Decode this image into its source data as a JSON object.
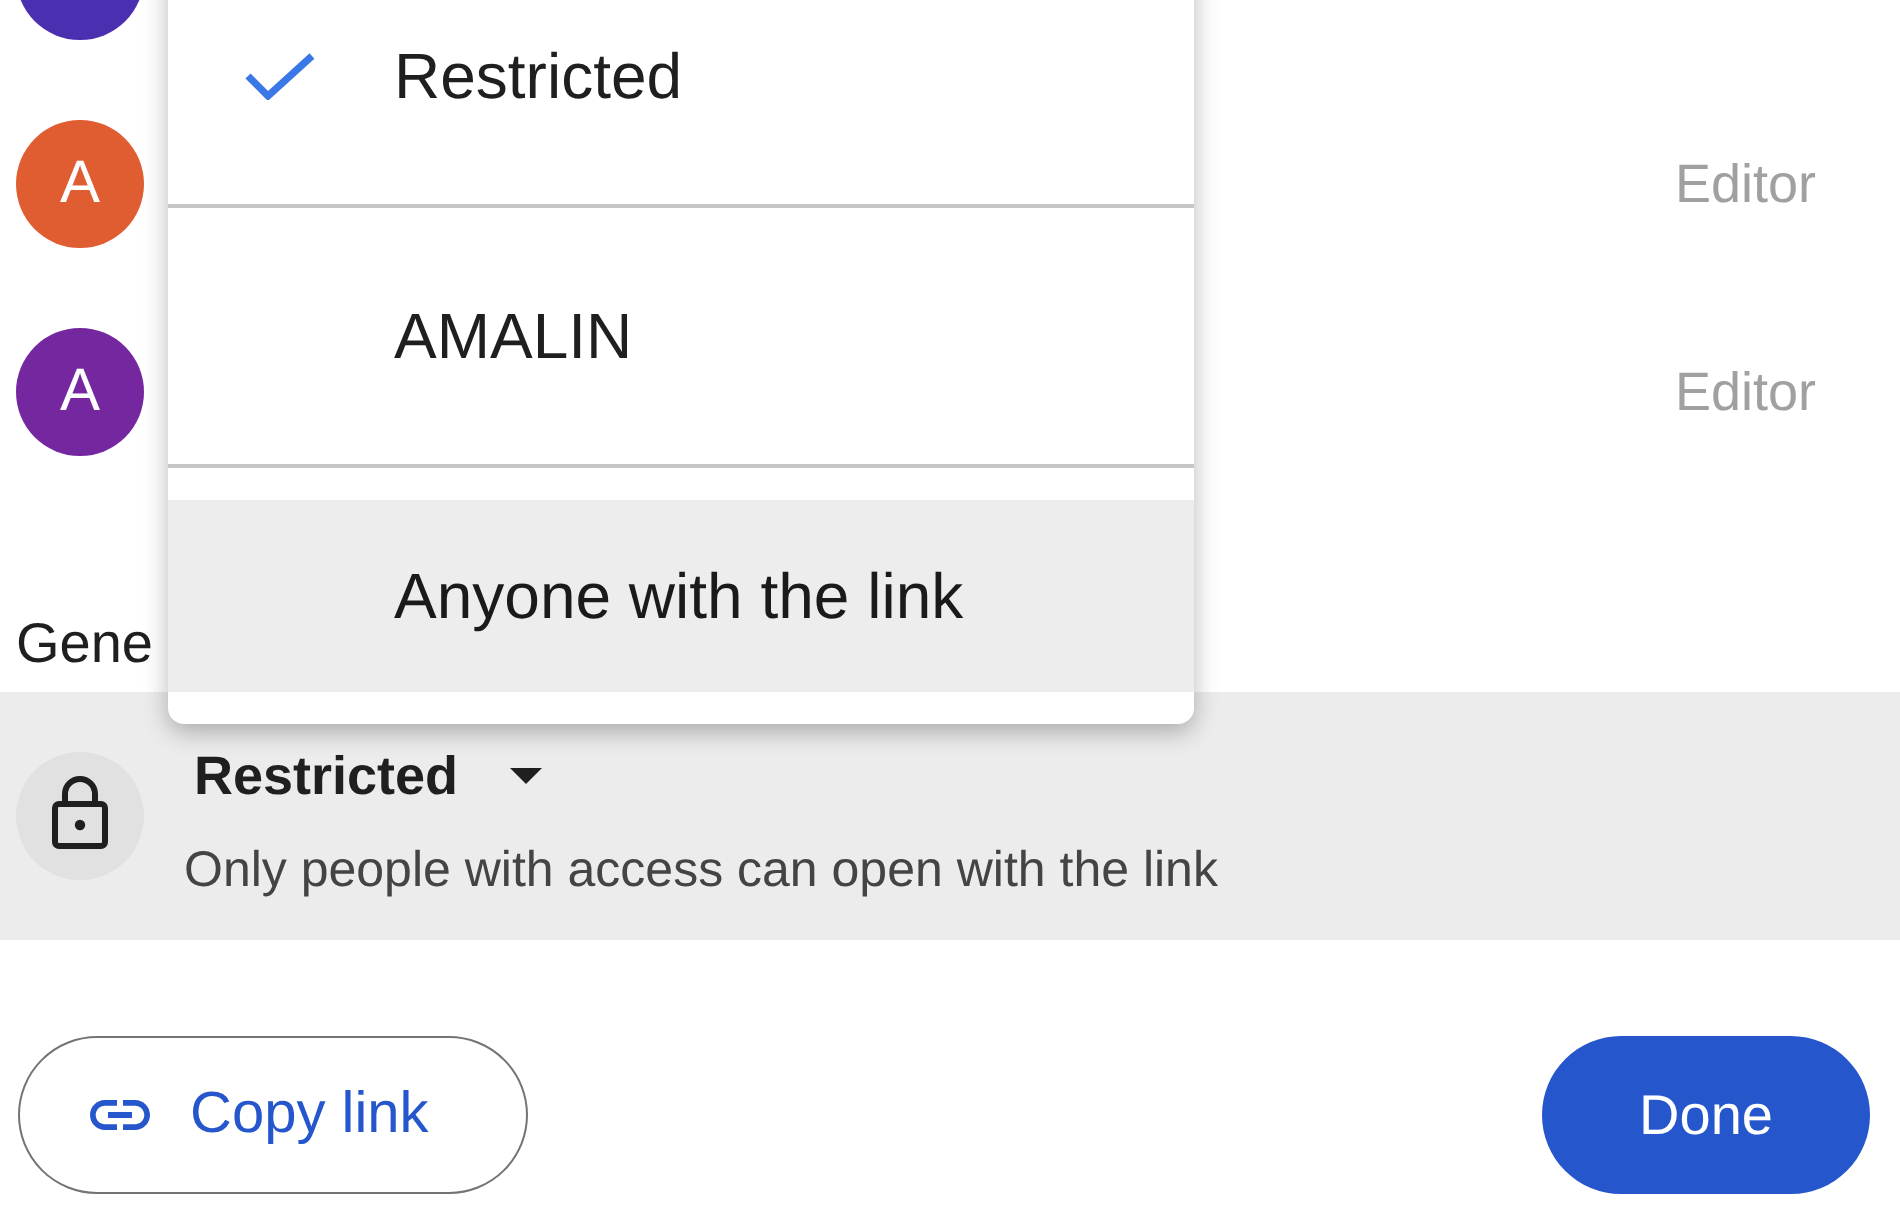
{
  "people": [
    {
      "color": "#4a2fb0"
    },
    {
      "initial": "A",
      "color": "#e05d32",
      "role": "Editor"
    },
    {
      "initial": "A",
      "color": "#7527a0",
      "role": "Editor"
    }
  ],
  "general_access": {
    "heading": "Gene",
    "selection": "Restricted",
    "description": "Only people with access can open with the link"
  },
  "access_menu": {
    "options": [
      {
        "label": "Restricted",
        "selected": true,
        "highlighted": false
      },
      {
        "label": "AMALIN",
        "selected": false,
        "highlighted": false
      },
      {
        "label": "Anyone with the link",
        "selected": false,
        "highlighted": true
      }
    ]
  },
  "buttons": [
    {
      "kind": "outlined",
      "label": "Copy link"
    },
    {
      "kind": "filled",
      "label": "Done"
    }
  ]
}
